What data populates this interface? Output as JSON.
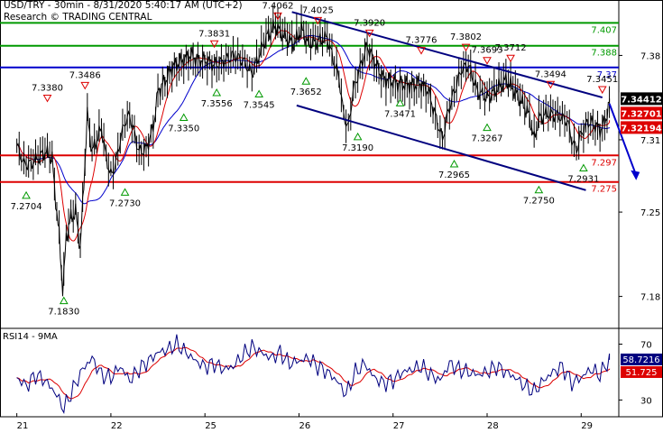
{
  "header": {
    "title": "USD/TRY - 30min - 8/31/2020 5:40:17 AM (UTC+2)",
    "subtitle": "Research © TRADING CENTRAL"
  },
  "chart_data": [
    {
      "type": "line",
      "name": "price-panel",
      "symbol": "USD/TRY",
      "timeframe": "30min",
      "ylim": [
        7.155,
        7.42
      ],
      "yticks": [
        7.18,
        7.25,
        7.31,
        7.38
      ],
      "x_labels": [
        "21",
        "22",
        "25",
        "26",
        "27",
        "28",
        "29"
      ],
      "x_label_positions": [
        0,
        20,
        40,
        60,
        80,
        100,
        120
      ],
      "x_range": [
        -3,
        128
      ],
      "grid": false,
      "price_points": [
        [
          0,
          7.305
        ],
        [
          1.5,
          7.29
        ],
        [
          3,
          7.29
        ],
        [
          4.5,
          7.295
        ],
        [
          6,
          7.3
        ],
        [
          7.5,
          7.295
        ],
        [
          8,
          7.27
        ],
        [
          9,
          7.23
        ],
        [
          9.8,
          7.183
        ],
        [
          10.5,
          7.23
        ],
        [
          11.5,
          7.245
        ],
        [
          12.5,
          7.25
        ],
        [
          13.5,
          7.22
        ],
        [
          14.2,
          7.27
        ],
        [
          15,
          7.33
        ],
        [
          16,
          7.3
        ],
        [
          17,
          7.31
        ],
        [
          18,
          7.32
        ],
        [
          19,
          7.295
        ],
        [
          20,
          7.28
        ],
        [
          21,
          7.29
        ],
        [
          22,
          7.31
        ],
        [
          23,
          7.325
        ],
        [
          24,
          7.33
        ],
        [
          26,
          7.3
        ],
        [
          27.5,
          7.302
        ],
        [
          29,
          7.32
        ],
        [
          30,
          7.35
        ],
        [
          32,
          7.362
        ],
        [
          33,
          7.37
        ],
        [
          35,
          7.375
        ],
        [
          37,
          7.38
        ],
        [
          38.5,
          7.376
        ],
        [
          40,
          7.376
        ],
        [
          42,
          7.372
        ],
        [
          44,
          7.375
        ],
        [
          46,
          7.38
        ],
        [
          48,
          7.376
        ],
        [
          50,
          7.365
        ],
        [
          51.5,
          7.38
        ],
        [
          53,
          7.395
        ],
        [
          55,
          7.405
        ],
        [
          57,
          7.395
        ],
        [
          59,
          7.39
        ],
        [
          60.5,
          7.402
        ],
        [
          62,
          7.39
        ],
        [
          64,
          7.392
        ],
        [
          66,
          7.395
        ],
        [
          67,
          7.38
        ],
        [
          68.5,
          7.362
        ],
        [
          69.5,
          7.33
        ],
        [
          70.5,
          7.32
        ],
        [
          71.5,
          7.35
        ],
        [
          73,
          7.37
        ],
        [
          74.5,
          7.388
        ],
        [
          76,
          7.375
        ],
        [
          78,
          7.36
        ],
        [
          80,
          7.358
        ],
        [
          82,
          7.356
        ],
        [
          84,
          7.355
        ],
        [
          86,
          7.356
        ],
        [
          87.5,
          7.35
        ],
        [
          89,
          7.33
        ],
        [
          90.5,
          7.31
        ],
        [
          91.5,
          7.33
        ],
        [
          93,
          7.35
        ],
        [
          94.5,
          7.368
        ],
        [
          96,
          7.372
        ],
        [
          98,
          7.35
        ],
        [
          100,
          7.345
        ],
        [
          102,
          7.352
        ],
        [
          104,
          7.36
        ],
        [
          106,
          7.35
        ],
        [
          107.5,
          7.34
        ],
        [
          109,
          7.33
        ],
        [
          110,
          7.31
        ],
        [
          111,
          7.328
        ],
        [
          113,
          7.332
        ],
        [
          115,
          7.33
        ],
        [
          117,
          7.326
        ],
        [
          118,
          7.31
        ],
        [
          119,
          7.302
        ],
        [
          120,
          7.315
        ],
        [
          121.5,
          7.325
        ],
        [
          123,
          7.322
        ],
        [
          124,
          7.318
        ],
        [
          125,
          7.324
        ],
        [
          126,
          7.34
        ]
      ],
      "last_price": 7.3441,
      "price_labels": {
        "last": "7.34412",
        "ask": "7.32701",
        "bid": "7.32194"
      },
      "horizontal_levels": [
        {
          "value": 7.407,
          "label": "7.407",
          "color": "#009900"
        },
        {
          "value": 7.388,
          "label": "7.388",
          "color": "#009900"
        },
        {
          "value": 7.37,
          "label": "7.37",
          "color": "#0000cc"
        },
        {
          "value": 7.297,
          "label": "7.297",
          "color": "#dd0000"
        },
        {
          "value": 7.275,
          "label": "7.275",
          "color": "#dd0000"
        }
      ],
      "trend_lines": [
        {
          "x1": 58.5,
          "y1": 7.416,
          "x2": 124.5,
          "y2": 7.3451,
          "color": "#00007f"
        },
        {
          "x1": 59.5,
          "y1": 7.3385,
          "x2": 121,
          "y2": 7.2682,
          "color": "#00007f"
        }
      ],
      "projection_arrow": {
        "x1": 126,
        "y1": 7.34,
        "x2": 131.5,
        "y2": 7.278,
        "color": "#0000cc"
      },
      "markers": [
        {
          "x": 2,
          "value": 7.2704,
          "label": "7.2704",
          "kind": "low"
        },
        {
          "x": 6.5,
          "value": 7.338,
          "label": "7.3380",
          "kind": "high"
        },
        {
          "x": 10,
          "value": 7.183,
          "label": "7.1830",
          "kind": "low"
        },
        {
          "x": 14.5,
          "value": 7.3486,
          "label": "7.3486",
          "kind": "high"
        },
        {
          "x": 23,
          "value": 7.273,
          "label": "7.2730",
          "kind": "low"
        },
        {
          "x": 35.5,
          "value": 7.335,
          "label": "7.3350",
          "kind": "low"
        },
        {
          "x": 42,
          "value": 7.3831,
          "label": "7.3831",
          "kind": "high"
        },
        {
          "x": 42.5,
          "value": 7.3556,
          "label": "7.3556",
          "kind": "low"
        },
        {
          "x": 51.5,
          "value": 7.3545,
          "label": "7.3545",
          "kind": "low"
        },
        {
          "x": 55.5,
          "value": 7.4062,
          "label": "7.4062",
          "kind": "high"
        },
        {
          "x": 61.5,
          "value": 7.3652,
          "label": "7.3652",
          "kind": "low"
        },
        {
          "x": 64,
          "value": 7.4025,
          "label": "7.4025",
          "kind": "high"
        },
        {
          "x": 72.5,
          "value": 7.319,
          "label": "7.3190",
          "kind": "low"
        },
        {
          "x": 75,
          "value": 7.392,
          "label": "7.3920",
          "kind": "high"
        },
        {
          "x": 81.5,
          "value": 7.3471,
          "label": "7.3471",
          "kind": "low"
        },
        {
          "x": 86,
          "value": 7.3776,
          "label": "7.3776",
          "kind": "high"
        },
        {
          "x": 93,
          "value": 7.2965,
          "label": "7.2965",
          "kind": "low"
        },
        {
          "x": 95.5,
          "value": 7.3802,
          "label": "7.3802",
          "kind": "high"
        },
        {
          "x": 100,
          "value": 7.3693,
          "label": "7.3693",
          "kind": "high"
        },
        {
          "x": 100,
          "value": 7.3267,
          "label": "7.3267",
          "kind": "low"
        },
        {
          "x": 105,
          "value": 7.3712,
          "label": "7.3712",
          "kind": "high"
        },
        {
          "x": 111,
          "value": 7.275,
          "label": "7.2750",
          "kind": "low"
        },
        {
          "x": 113.5,
          "value": 7.3494,
          "label": "7.3494",
          "kind": "high"
        },
        {
          "x": 120.5,
          "value": 7.2931,
          "label": "7.2931",
          "kind": "low"
        },
        {
          "x": 124.5,
          "value": 7.3451,
          "label": "7.3451",
          "kind": "high"
        }
      ],
      "colors": {
        "price": "#000000",
        "ma_fast": "#dd0000",
        "ma_slow": "#0000cc",
        "up_marker": "#009900",
        "down_marker": "#dd0000"
      }
    },
    {
      "type": "line",
      "name": "rsi-panel",
      "title": "RSI14 - 9MA",
      "ylim": [
        18,
        80
      ],
      "yticks": [
        30,
        70
      ],
      "x_range": [
        -3,
        128
      ],
      "rsi_points": [
        [
          0,
          46
        ],
        [
          2,
          40
        ],
        [
          4,
          48
        ],
        [
          6,
          44
        ],
        [
          8,
          36
        ],
        [
          10,
          24
        ],
        [
          12,
          38
        ],
        [
          14,
          52
        ],
        [
          16,
          60
        ],
        [
          18,
          48
        ],
        [
          20,
          46
        ],
        [
          22,
          54
        ],
        [
          24,
          44
        ],
        [
          26,
          52
        ],
        [
          28,
          58
        ],
        [
          30,
          64
        ],
        [
          32,
          66
        ],
        [
          34,
          70
        ],
        [
          36,
          64
        ],
        [
          38,
          58
        ],
        [
          40,
          54
        ],
        [
          42,
          56
        ],
        [
          44,
          52
        ],
        [
          46,
          54
        ],
        [
          48,
          62
        ],
        [
          50,
          68
        ],
        [
          52,
          64
        ],
        [
          54,
          60
        ],
        [
          56,
          64
        ],
        [
          58,
          56
        ],
        [
          60,
          58
        ],
        [
          62,
          60
        ],
        [
          64,
          54
        ],
        [
          66,
          50
        ],
        [
          68,
          44
        ],
        [
          70,
          34
        ],
        [
          72,
          50
        ],
        [
          74,
          56
        ],
        [
          76,
          46
        ],
        [
          78,
          42
        ],
        [
          80,
          44
        ],
        [
          82,
          50
        ],
        [
          84,
          52
        ],
        [
          86,
          54
        ],
        [
          88,
          48
        ],
        [
          90,
          44
        ],
        [
          92,
          56
        ],
        [
          94,
          52
        ],
        [
          96,
          50
        ],
        [
          98,
          48
        ],
        [
          100,
          50
        ],
        [
          102,
          54
        ],
        [
          104,
          50
        ],
        [
          106,
          46
        ],
        [
          108,
          40
        ],
        [
          110,
          36
        ],
        [
          112,
          44
        ],
        [
          114,
          50
        ],
        [
          116,
          54
        ],
        [
          118,
          42
        ],
        [
          120,
          46
        ],
        [
          122,
          52
        ],
        [
          124,
          48
        ],
        [
          126,
          59
        ]
      ],
      "last_rsi": 58.72,
      "last_ma": 51.725,
      "value_labels": {
        "rsi": "58.7216",
        "ma": "51.725"
      },
      "colors": {
        "rsi": "#00007f",
        "ma": "#dd0000",
        "rsi_label_bg": "#00007f",
        "ma_label_bg": "#dd0000"
      }
    }
  ]
}
